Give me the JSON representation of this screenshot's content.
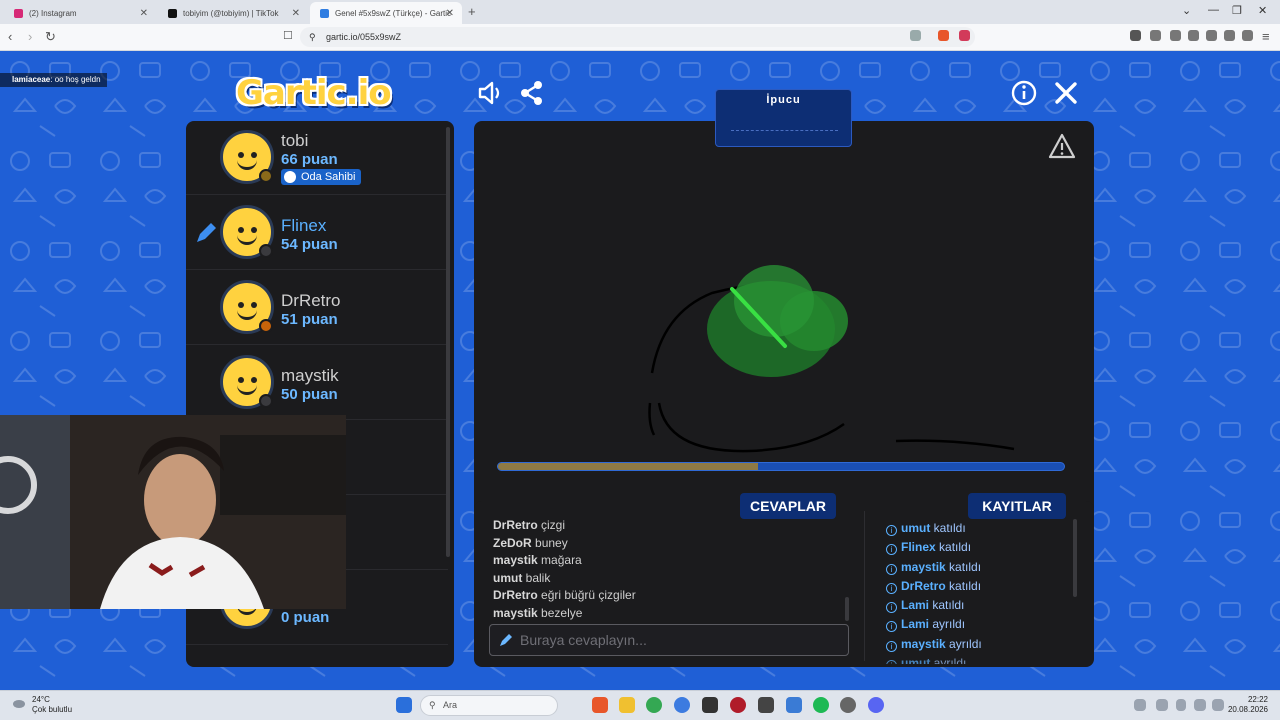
{
  "browser": {
    "tabs": [
      {
        "title": "(2) Instagram",
        "color": "#d62976"
      },
      {
        "title": "tobiyim (@tobiyim) | TikTok",
        "color": "#111111"
      },
      {
        "title": "Genel #5x9swZ (Türkçe) - Gartic",
        "color": "#2f7de1"
      }
    ],
    "url": "gartic.io/055x9swZ"
  },
  "stream_chat": {
    "user": "lamiaceae",
    "message": ": oo hoş geldn"
  },
  "logo": "Gartic.io",
  "hint_title": "İpucu",
  "players": [
    {
      "name": "tobi",
      "points": "66 puan",
      "badge": "Oda Sahibi",
      "status_color": "#8a6a1a"
    },
    {
      "name": "Flinex",
      "points": "54 puan",
      "status_color": "#3a3a3e"
    },
    {
      "name": "DrRetro",
      "points": "51 puan",
      "status_color": "#c8640a"
    },
    {
      "name": "maystik",
      "points": "50 puan",
      "status_color": "#3a3a3e"
    },
    {
      "name": "",
      "points": "0 puan",
      "status_color": "#3a3a3e"
    }
  ],
  "timer_progress": 0.46,
  "answers_tab": "CEVAPLAR",
  "logs_tab": "KAYITLAR",
  "answers": [
    {
      "user": "DrRetro",
      "text": "çizgi"
    },
    {
      "user": "ZeDoR",
      "text": "buney"
    },
    {
      "user": "maystik",
      "text": "mağara"
    },
    {
      "user": "umut",
      "text": "balik"
    },
    {
      "user": "DrRetro",
      "text": "eğri büğrü çizgiler"
    },
    {
      "user": "maystik",
      "text": "bezelye"
    }
  ],
  "logs": [
    {
      "user": "umut",
      "action": "katıldı"
    },
    {
      "user": "Flinex",
      "action": "katıldı"
    },
    {
      "user": "maystik",
      "action": "katıldı"
    },
    {
      "user": "DrRetro",
      "action": "katıldı"
    },
    {
      "user": "Lami",
      "action": "katıldı"
    },
    {
      "user": "Lami",
      "action": "ayrıldı"
    },
    {
      "user": "maystik",
      "action": "ayrıldı"
    },
    {
      "user": "umut",
      "action": "ayrıldı"
    }
  ],
  "answer_placeholder": "Buraya cevaplayın...",
  "taskbar": {
    "temp": "24°C",
    "weather": "Çok bulutlu",
    "search": "Ara",
    "time": "22:22",
    "date": "20.08.2026"
  },
  "colors": {
    "page_bg": "#1f5fd6",
    "panel_bg": "#1b1b1d",
    "accent": "#5ab0ff",
    "logo": "#ffd23f"
  }
}
